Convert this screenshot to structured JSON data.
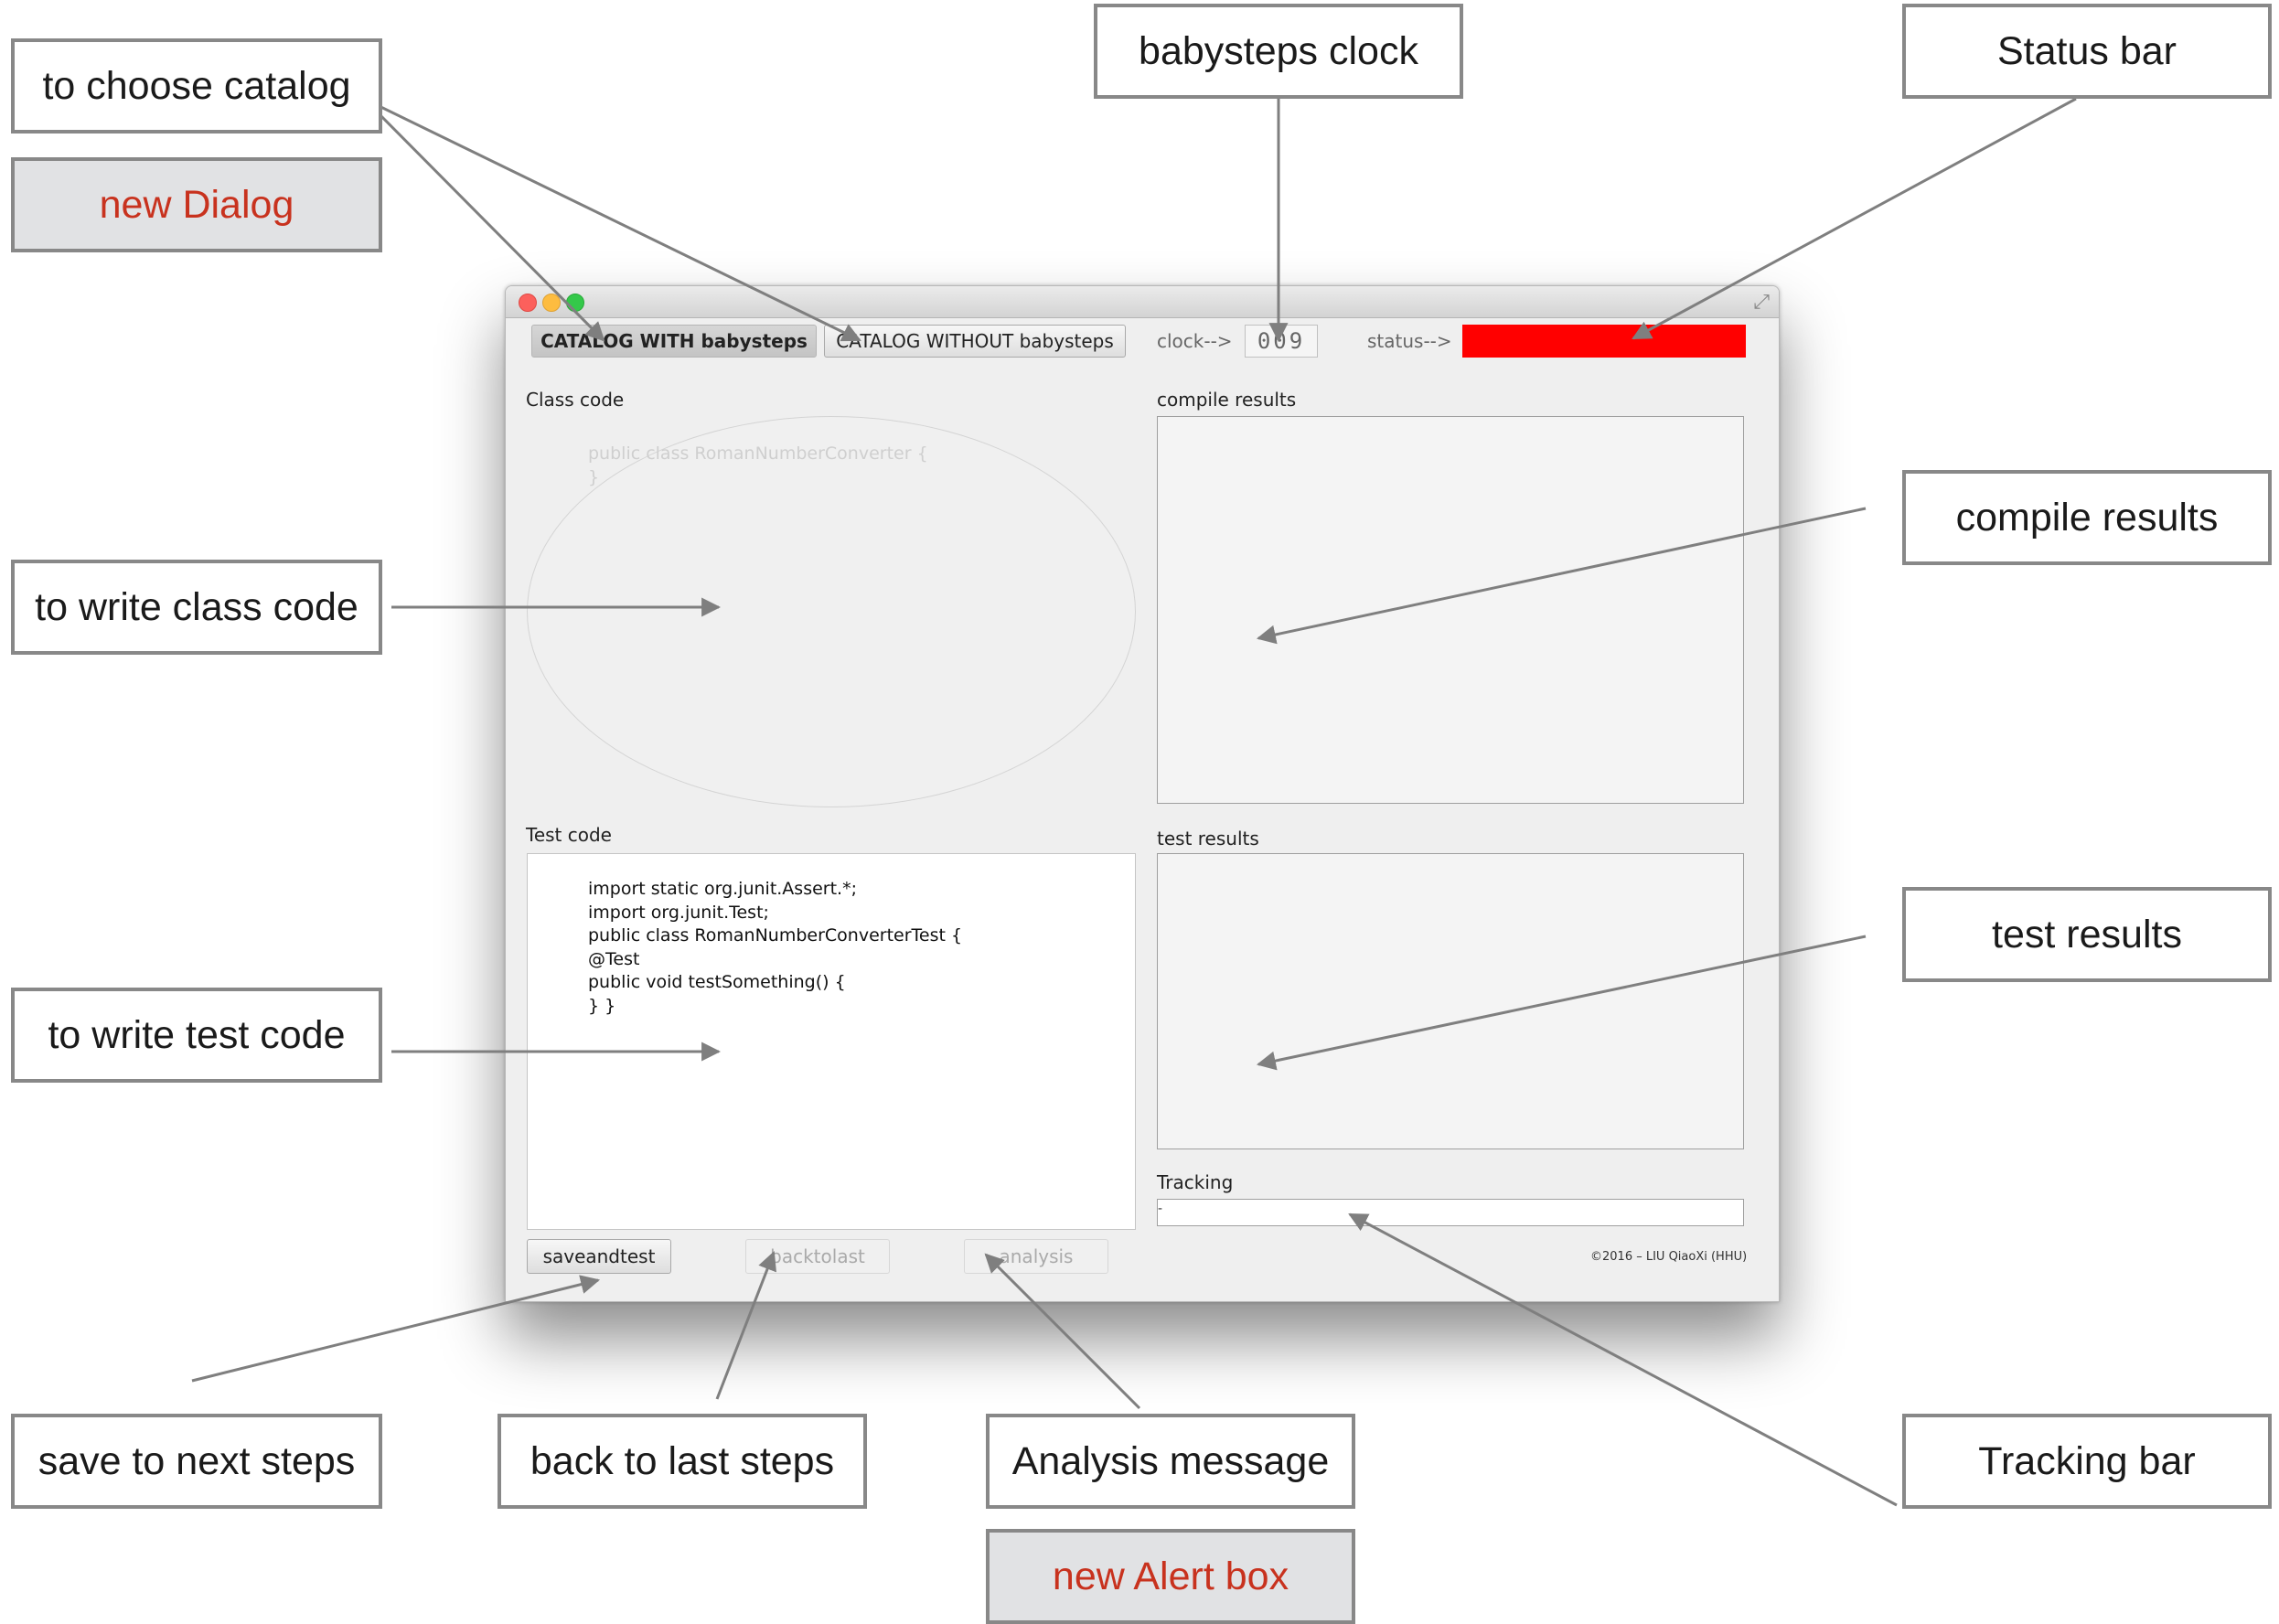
{
  "annotations": {
    "choose_catalog": "to choose catalog",
    "new_dialog": "new Dialog",
    "babysteps_clock": "babysteps clock",
    "status_bar": "Status bar",
    "write_class_code": "to write class code",
    "compile_results": "compile results",
    "write_test_code": "to write test code",
    "test_results": "test results",
    "save_next_steps": "save to next steps",
    "back_last_steps": "back to last steps",
    "analysis_message": "Analysis message",
    "new_alert_box": "new Alert box",
    "tracking_bar": "Tracking bar"
  },
  "app": {
    "catalog_with": "CATALOG WITH babysteps",
    "catalog_without": "CATALOG WITHOUT babysteps",
    "clock_label": "clock-->",
    "clock_value": "009",
    "status_label": "status-->",
    "status_color": "#ff0000",
    "class_code_label": "Class code",
    "class_code_lines": [
      "public class RomanNumberConverter {",
      "}"
    ],
    "compile_results_label": "compile results",
    "test_code_label": "Test code",
    "test_code_lines": [
      "import static org.junit.Assert.*;",
      "import org.junit.Test;",
      "public class RomanNumberConverterTest {",
      "@Test",
      "public void testSomething() {",
      "} }"
    ],
    "test_results_label": "test results",
    "tracking_label": "Tracking",
    "tracking_value": "-",
    "save_button": "saveandtest",
    "back_button": "backtolast",
    "analysis_button": "analysis",
    "copyright": "©2016 – LIU QiaoXi (HHU)"
  },
  "icons": {
    "fullscreen": "fullscreen-arrows-icon",
    "close": "close-traffic-light-icon",
    "minimize": "minimize-traffic-light-icon",
    "zoom": "zoom-traffic-light-icon"
  }
}
